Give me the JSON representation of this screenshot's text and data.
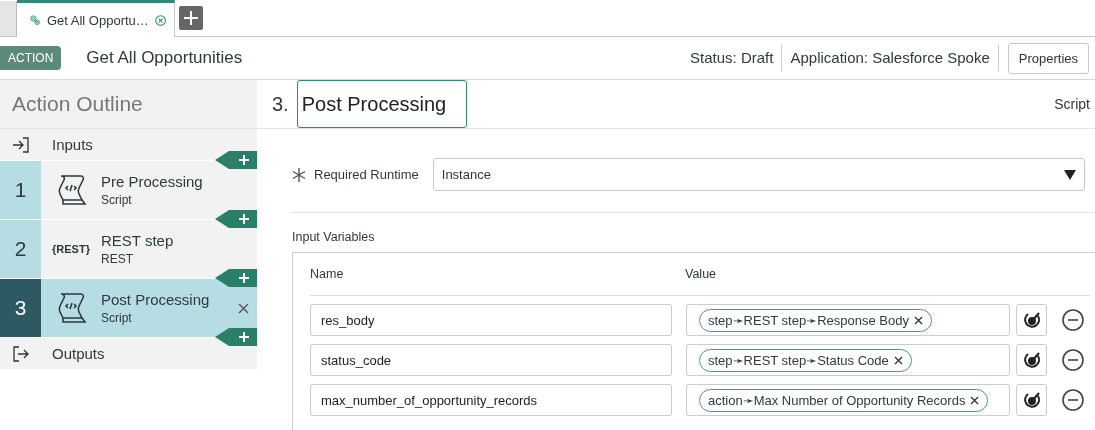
{
  "tabs": [
    {
      "selected": false
    },
    {
      "label": "Get All Opportu…",
      "selected": true
    }
  ],
  "header": {
    "badge": "ACTION",
    "title": "Get All Opportunities",
    "status": "Status: Draft",
    "application": "Application: Salesforce Spoke",
    "button": "Properties"
  },
  "outline": {
    "title": "Action Outline",
    "inputs": "Inputs",
    "outputs": "Outputs",
    "steps": [
      {
        "number": "1",
        "title": "Pre Processing",
        "subtitle": "Script",
        "kind": "script",
        "selected": false
      },
      {
        "number": "2",
        "title": "REST step",
        "subtitle": "REST",
        "kind": "rest",
        "icon_text": "{REST}",
        "selected": false
      },
      {
        "number": "3",
        "title": "Post Processing",
        "subtitle": "Script",
        "kind": "script",
        "selected": true
      }
    ]
  },
  "step": {
    "number": "3.",
    "name": "Post Processing",
    "type": "Script",
    "runtime_label": "Required Runtime",
    "runtime_value": "Instance",
    "section": "Input Variables",
    "columns": [
      "Name",
      "Value"
    ],
    "variables": [
      {
        "name": "res_body",
        "value": "step➛REST step➛Response Body"
      },
      {
        "name": "status_code",
        "value": "step➛REST step➛Status Code"
      },
      {
        "name": "max_number_of_opportunity_records",
        "value": "action➛Max Number of Opportunity Records"
      }
    ]
  }
}
